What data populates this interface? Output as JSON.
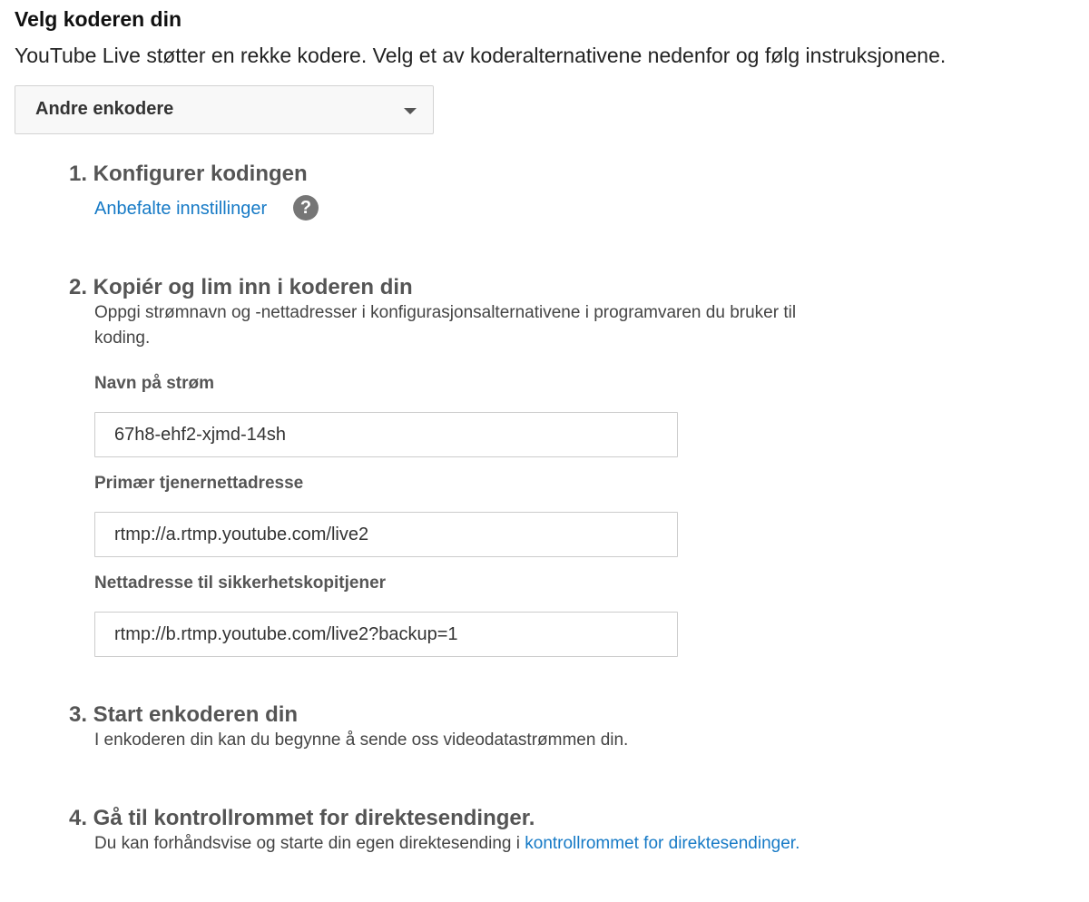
{
  "header": {
    "title": "Velg koderen din",
    "description": "YouTube Live støtter en rekke kodere. Velg et av koderalternativene nedenfor og følg instruksjonene."
  },
  "encoder_select": {
    "selected": "Andre enkodere"
  },
  "steps": [
    {
      "title": "1. Konfigurer kodingen",
      "link": "Anbefalte innstillinger",
      "help_icon": "question-mark-icon",
      "help_glyph": "?"
    },
    {
      "title": "2. Kopiér og lim inn i koderen din",
      "text_line1": "Oppgi strømnavn og -nettadresser i konfigurasjonsalternativene i programvaren du bruker til",
      "text_line2": "koding."
    },
    {
      "title": "3. Start enkoderen din",
      "text": "I enkoderen din kan du begynne å sende oss videodatastrømmen din."
    },
    {
      "title": "4. Gå til kontrollrommet for direktesendinger.",
      "text_prefix": "Du kan forhåndsvise og starte din egen direktesending i ",
      "link": "kontrollrommet for direktesendinger",
      "text_suffix": "."
    }
  ],
  "fields": [
    {
      "label": "Navn på strøm",
      "value": "67h8-ehf2-xjmd-14sh"
    },
    {
      "label": "Primær tjenernettadresse",
      "value": "rtmp://a.rtmp.youtube.com/live2"
    },
    {
      "label": "Nettadresse til sikkerhetskopitjener",
      "value": "rtmp://b.rtmp.youtube.com/live2?backup=1"
    }
  ],
  "colors": {
    "link": "#167ac6",
    "step_title": "#555555",
    "select_background": "#f8f8f8"
  }
}
